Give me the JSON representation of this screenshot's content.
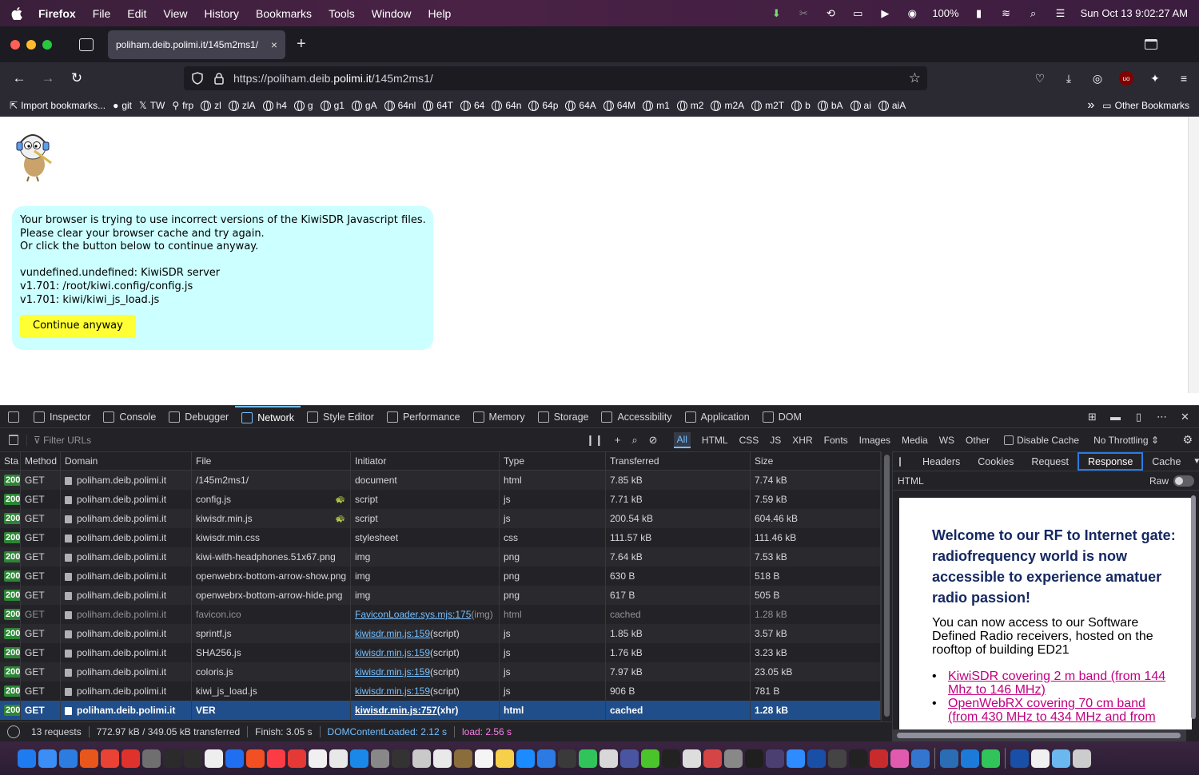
{
  "menubar": {
    "app_name": "Firefox",
    "menus": [
      "File",
      "Edit",
      "View",
      "History",
      "Bookmarks",
      "Tools",
      "Window",
      "Help"
    ],
    "battery": "100%",
    "clock": "Sun Oct 13  9:02:27 AM"
  },
  "browser": {
    "tab_title": "poliham.deib.polimi.it/145m2ms1/",
    "url_prefix": "https://poliham.deib.",
    "url_host": "polimi.it",
    "url_path": "/145m2ms1/",
    "tab_close": "×",
    "new_tab": "+"
  },
  "bookmarks": {
    "import": "Import bookmarks...",
    "items": [
      "git",
      "TW",
      "frp",
      "zl",
      "zlA",
      "h4",
      "g",
      "g1",
      "gA",
      "64nl",
      "64T",
      "64",
      "64n",
      "64p",
      "64A",
      "64M",
      "m1",
      "m2",
      "m2A",
      "m2T",
      "b",
      "bA",
      "ai",
      "aiA"
    ],
    "other": "Other Bookmarks",
    "overflow": "»"
  },
  "page": {
    "message_lines": [
      "Your browser is trying to use incorrect versions of the KiwiSDR Javascript files.",
      "Please clear your browser cache and try again.",
      "Or click the button below to continue anyway."
    ],
    "version_lines": [
      "vundefined.undefined: KiwiSDR server",
      "v1.701: /root/kiwi.config/config.js",
      "v1.701: kiwi/kiwi_js_load.js"
    ],
    "continue_button": "Continue anyway"
  },
  "devtools": {
    "tabs": [
      "Inspector",
      "Console",
      "Debugger",
      "Network",
      "Style Editor",
      "Performance",
      "Memory",
      "Storage",
      "Accessibility",
      "Application",
      "DOM"
    ],
    "active_tab": "Network",
    "filter_placeholder": "Filter URLs",
    "type_filters": [
      "All",
      "HTML",
      "CSS",
      "JS",
      "XHR",
      "Fonts",
      "Images",
      "Media",
      "WS",
      "Other"
    ],
    "disable_cache": "Disable Cache",
    "throttling": "No Throttling ⇕"
  },
  "network": {
    "columns": [
      "Sta",
      "Method",
      "Domain",
      "File",
      "Initiator",
      "Type",
      "Transferred",
      "Size"
    ],
    "rows": [
      {
        "status": "200",
        "method": "GET",
        "domain": "poliham.deib.polimi.it",
        "file": "/145m2ms1/",
        "initiator": "document",
        "init_link": "",
        "init_suffix": "",
        "type": "html",
        "transferred": "7.85 kB",
        "size": "7.74 kB"
      },
      {
        "status": "200",
        "method": "GET",
        "domain": "poliham.deib.polimi.it",
        "file": "config.js",
        "initiator": "script",
        "init_link": "",
        "init_suffix": "",
        "type": "js",
        "transferred": "7.71 kB",
        "size": "7.59 kB"
      },
      {
        "status": "200",
        "method": "GET",
        "domain": "poliham.deib.polimi.it",
        "file": "kiwisdr.min.js",
        "initiator": "script",
        "init_link": "",
        "init_suffix": "",
        "type": "js",
        "transferred": "200.54 kB",
        "size": "604.46 kB"
      },
      {
        "status": "200",
        "method": "GET",
        "domain": "poliham.deib.polimi.it",
        "file": "kiwisdr.min.css",
        "initiator": "stylesheet",
        "init_link": "",
        "init_suffix": "",
        "type": "css",
        "transferred": "111.57 kB",
        "size": "111.46 kB"
      },
      {
        "status": "200",
        "method": "GET",
        "domain": "poliham.deib.polimi.it",
        "file": "kiwi-with-headphones.51x67.png",
        "initiator": "img",
        "init_link": "",
        "init_suffix": "",
        "type": "png",
        "transferred": "7.64 kB",
        "size": "7.53 kB"
      },
      {
        "status": "200",
        "method": "GET",
        "domain": "poliham.deib.polimi.it",
        "file": "openwebrx-bottom-arrow-show.png",
        "initiator": "img",
        "init_link": "",
        "init_suffix": "",
        "type": "png",
        "transferred": "630 B",
        "size": "518 B"
      },
      {
        "status": "200",
        "method": "GET",
        "domain": "poliham.deib.polimi.it",
        "file": "openwebrx-bottom-arrow-hide.png",
        "initiator": "img",
        "init_link": "",
        "init_suffix": "",
        "type": "png",
        "transferred": "617 B",
        "size": "505 B"
      },
      {
        "status": "200",
        "method": "GET",
        "domain": "poliham.deib.polimi.it",
        "file": "favicon.ico",
        "initiator": "",
        "init_link": "FaviconLoader.sys.mjs:175",
        "init_suffix": " (img)",
        "type": "html",
        "transferred": "cached",
        "size": "1.28 kB"
      },
      {
        "status": "200",
        "method": "GET",
        "domain": "poliham.deib.polimi.it",
        "file": "sprintf.js",
        "initiator": "",
        "init_link": "kiwisdr.min.js:159",
        "init_suffix": " (script)",
        "type": "js",
        "transferred": "1.85 kB",
        "size": "3.57 kB"
      },
      {
        "status": "200",
        "method": "GET",
        "domain": "poliham.deib.polimi.it",
        "file": "SHA256.js",
        "initiator": "",
        "init_link": "kiwisdr.min.js:159",
        "init_suffix": " (script)",
        "type": "js",
        "transferred": "1.76 kB",
        "size": "3.23 kB"
      },
      {
        "status": "200",
        "method": "GET",
        "domain": "poliham.deib.polimi.it",
        "file": "coloris.js",
        "initiator": "",
        "init_link": "kiwisdr.min.js:159",
        "init_suffix": " (script)",
        "type": "js",
        "transferred": "7.97 kB",
        "size": "23.05 kB"
      },
      {
        "status": "200",
        "method": "GET",
        "domain": "poliham.deib.polimi.it",
        "file": "kiwi_js_load.js",
        "initiator": "",
        "init_link": "kiwisdr.min.js:159",
        "init_suffix": " (script)",
        "type": "js",
        "transferred": "906 B",
        "size": "781 B"
      },
      {
        "status": "200",
        "method": "GET",
        "domain": "poliham.deib.polimi.it",
        "file": "VER",
        "initiator": "",
        "init_link": "kiwisdr.min.js:757",
        "init_suffix": " (xhr)",
        "type": "html",
        "transferred": "cached",
        "size": "1.28 kB"
      }
    ],
    "cached_row_index": 7,
    "selected_row_index": 12,
    "status_bar": {
      "requests": "13 requests",
      "transferred": "772.97 kB / 349.05 kB transferred",
      "finish": "Finish: 3.05 s",
      "dcl": "DOMContentLoaded: 2.12 s",
      "load": "load: 2.56 s"
    }
  },
  "side_panel": {
    "tabs": [
      "Headers",
      "Cookies",
      "Request",
      "Response",
      "Cache"
    ],
    "active_tab": "Response",
    "section": "HTML",
    "raw_label": "Raw",
    "preview_heading": "Welcome to our RF to Internet gate: radiofrequency world is now accessible to experience amatuer radio passion!",
    "preview_text": "You can now access to our Software Defined Radio receivers, hosted on the rooftop of building ED21",
    "preview_links": [
      "KiwiSDR covering 2 m band (from 144 Mhz to 146 MHz)",
      "OpenWebRX covering 70 cm band (from 430 MHz to 434 MHz and from"
    ]
  },
  "colors": {
    "accent": "#75bfff",
    "status_ok": "#2d8636",
    "selected_row": "#204e8a",
    "message_bg": "#ccffff",
    "continue_bg": "#ffff33"
  }
}
